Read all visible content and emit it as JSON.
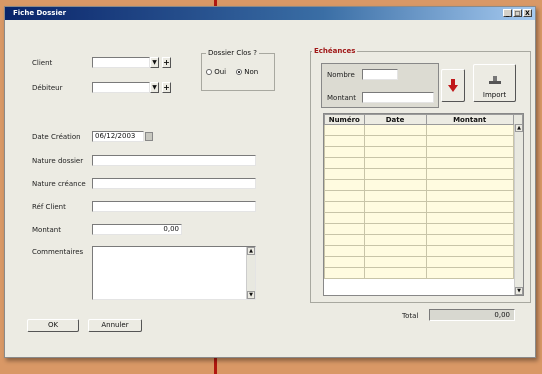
{
  "window": {
    "title": "Fiche Dossier",
    "min": "_",
    "max": "□",
    "close": "X"
  },
  "form": {
    "client_label": "Client",
    "debiteur_label": "Débiteur",
    "plus": "+",
    "dropdown_arrow": "▼",
    "dossier_clos": {
      "title": "Dossier Clos ?",
      "oui": "Oui",
      "non": "Non",
      "selected": "Non"
    },
    "date_creation_label": "Date Création",
    "date_creation_value": "06/12/2003",
    "nature_dossier_label": "Nature dossier",
    "nature_creance_label": "Nature créance",
    "ref_client_label": "Réf Client",
    "montant_label": "Montant",
    "montant_value": "0,00",
    "commentaires_label": "Commentaires"
  },
  "echeances": {
    "title": "Echéances",
    "nombre_label": "Nombre",
    "montant_label": "Montant",
    "import_label": "Import",
    "columns": [
      "Numéro",
      "Date",
      "Montant"
    ],
    "row_count": 14,
    "total_label": "Total",
    "total_value": "0,00"
  },
  "buttons": {
    "ok": "OK",
    "annuler": "Annuler"
  },
  "colors": {
    "background": "#d99866",
    "titlebar": "#0a246a",
    "grid_row": "#fffbe0",
    "echeances_title": "#a01818"
  }
}
